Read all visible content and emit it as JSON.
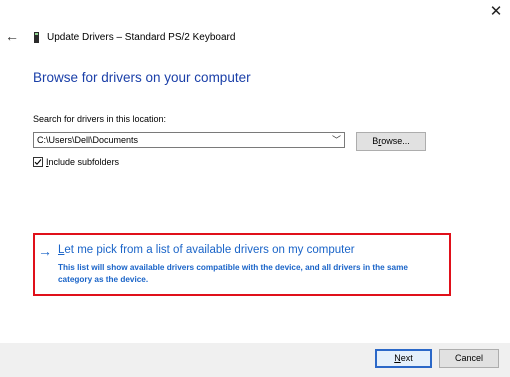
{
  "window": {
    "close_glyph": "✕",
    "back_glyph": "←",
    "title": "Update Drivers – Standard PS/2 Keyboard"
  },
  "page": {
    "heading": "Browse for drivers on your computer"
  },
  "location": {
    "label": "Search for drivers in this location:",
    "value": "C:\\Users\\Dell\\Documents",
    "dropdown_glyph": "﹀",
    "browse_first": "B",
    "browse_underlined": "r",
    "browse_rest": "owse..."
  },
  "subfolders": {
    "checked": true,
    "label_underlined": "I",
    "label_rest": "nclude subfolders"
  },
  "pick": {
    "arrow_glyph": "→",
    "link_underlined": "L",
    "link_rest": "et me pick from a list of available drivers on my computer",
    "description": "This list will show available drivers compatible with the device, and all drivers in the same category as the device."
  },
  "footer": {
    "next_underlined": "N",
    "next_rest": "ext",
    "cancel_label": "Cancel"
  },
  "colors": {
    "link_blue": "#1a64c8",
    "heading_blue": "#1a3fa8",
    "highlight_red": "#e0101a"
  }
}
